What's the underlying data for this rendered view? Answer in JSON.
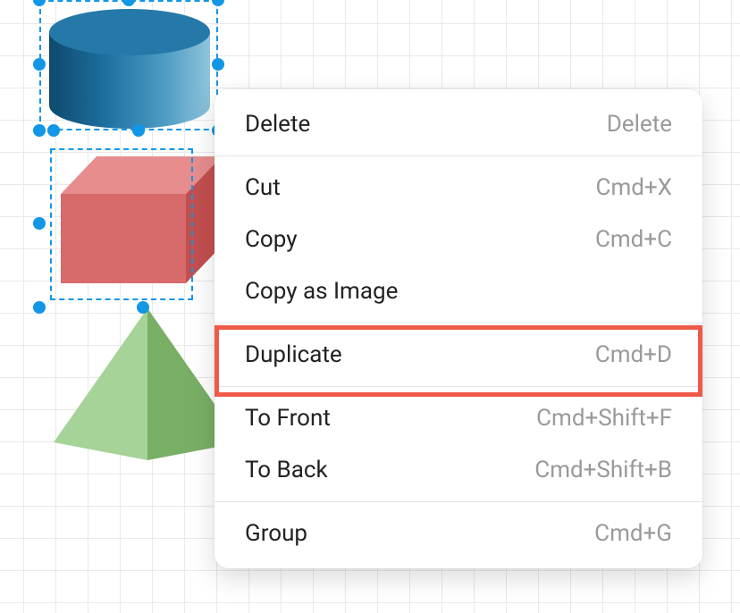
{
  "context_menu": {
    "items": [
      {
        "label": "Delete",
        "shortcut": "Delete",
        "sep_after": true,
        "highlighted": false
      },
      {
        "label": "Cut",
        "shortcut": "Cmd+X",
        "sep_after": false,
        "highlighted": false
      },
      {
        "label": "Copy",
        "shortcut": "Cmd+C",
        "sep_after": false,
        "highlighted": false
      },
      {
        "label": "Copy as Image",
        "shortcut": "",
        "sep_after": true,
        "highlighted": false
      },
      {
        "label": "Duplicate",
        "shortcut": "Cmd+D",
        "sep_after": true,
        "highlighted": true
      },
      {
        "label": "To Front",
        "shortcut": "Cmd+Shift+F",
        "sep_after": false,
        "highlighted": false
      },
      {
        "label": "To Back",
        "shortcut": "Cmd+Shift+B",
        "sep_after": true,
        "highlighted": false
      },
      {
        "label": "Group",
        "shortcut": "Cmd+G",
        "sep_after": false,
        "highlighted": false
      }
    ]
  },
  "shapes": {
    "cylinder": {
      "name": "cylinder",
      "selected": true,
      "colors": [
        "#2579a9",
        "#0e4a6d",
        "#4a9ac2"
      ]
    },
    "cube": {
      "name": "cube",
      "selected": true,
      "colors": [
        "#d36060",
        "#e78d8d",
        "#c34f4f"
      ]
    },
    "pyramid": {
      "name": "pyramid",
      "selected": true,
      "colors": [
        "#8bc17b",
        "#a6d397",
        "#78af65"
      ]
    }
  },
  "selection_color": "#1296e6",
  "highlight_color": "#ef5a48"
}
